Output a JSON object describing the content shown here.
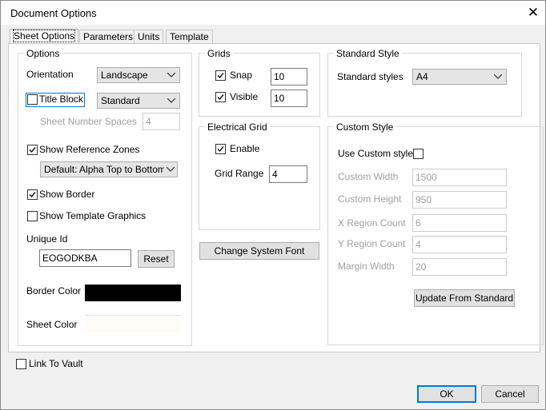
{
  "window": {
    "title": "Document Options",
    "close_icon": "close-icon"
  },
  "tabs": [
    {
      "label": "Sheet Options",
      "active": true
    },
    {
      "label": "Parameters"
    },
    {
      "label": "Units"
    },
    {
      "label": "Template"
    }
  ],
  "options": {
    "legend": "Options",
    "orientation_label": "Orientation",
    "orientation_value": "Landscape",
    "title_block_label": "Title Block",
    "title_block_checked": false,
    "title_block_value": "Standard",
    "sheet_number_spaces_label": "Sheet Number Spaces",
    "sheet_number_spaces_value": "4",
    "show_reference_zones_label": "Show Reference Zones",
    "show_reference_zones_checked": true,
    "reference_zones_value": "Default: Alpha Top to Bottom",
    "show_border_label": "Show Border",
    "show_border_checked": true,
    "show_template_graphics_label": "Show Template Graphics",
    "show_template_graphics_checked": false,
    "unique_id_label": "Unique Id",
    "unique_id_value": "EOGODKBA",
    "reset_label": "Reset",
    "border_color_label": "Border Color",
    "border_color": "#000000",
    "sheet_color_label": "Sheet Color",
    "sheet_color": "#fffcf8"
  },
  "grids": {
    "legend": "Grids",
    "snap_label": "Snap",
    "snap_checked": true,
    "snap_value": "10",
    "visible_label": "Visible",
    "visible_checked": true,
    "visible_value": "10"
  },
  "electrical_grid": {
    "legend": "Electrical Grid",
    "enable_label": "Enable",
    "enable_checked": true,
    "grid_range_label": "Grid Range",
    "grid_range_value": "4"
  },
  "change_system_font_label": "Change System Font",
  "standard_style": {
    "legend": "Standard Style",
    "styles_label": "Standard styles",
    "styles_value": "A4"
  },
  "custom_style": {
    "legend": "Custom Style",
    "use_custom_label": "Use Custom style",
    "use_custom_checked": false,
    "custom_width_label": "Custom Width",
    "custom_width_value": "1500",
    "custom_height_label": "Custom Height",
    "custom_height_value": "950",
    "x_region_label": "X Region Count",
    "x_region_value": "6",
    "y_region_label": "Y Region Count",
    "y_region_value": "4",
    "margin_width_label": "Margin Width",
    "margin_width_value": "20",
    "update_label": "Update From Standard"
  },
  "footer": {
    "link_to_vault_label": "Link To Vault",
    "link_to_vault_checked": false,
    "ok_label": "OK",
    "cancel_label": "Cancel"
  },
  "colors": {
    "accent": "#0078d7"
  }
}
